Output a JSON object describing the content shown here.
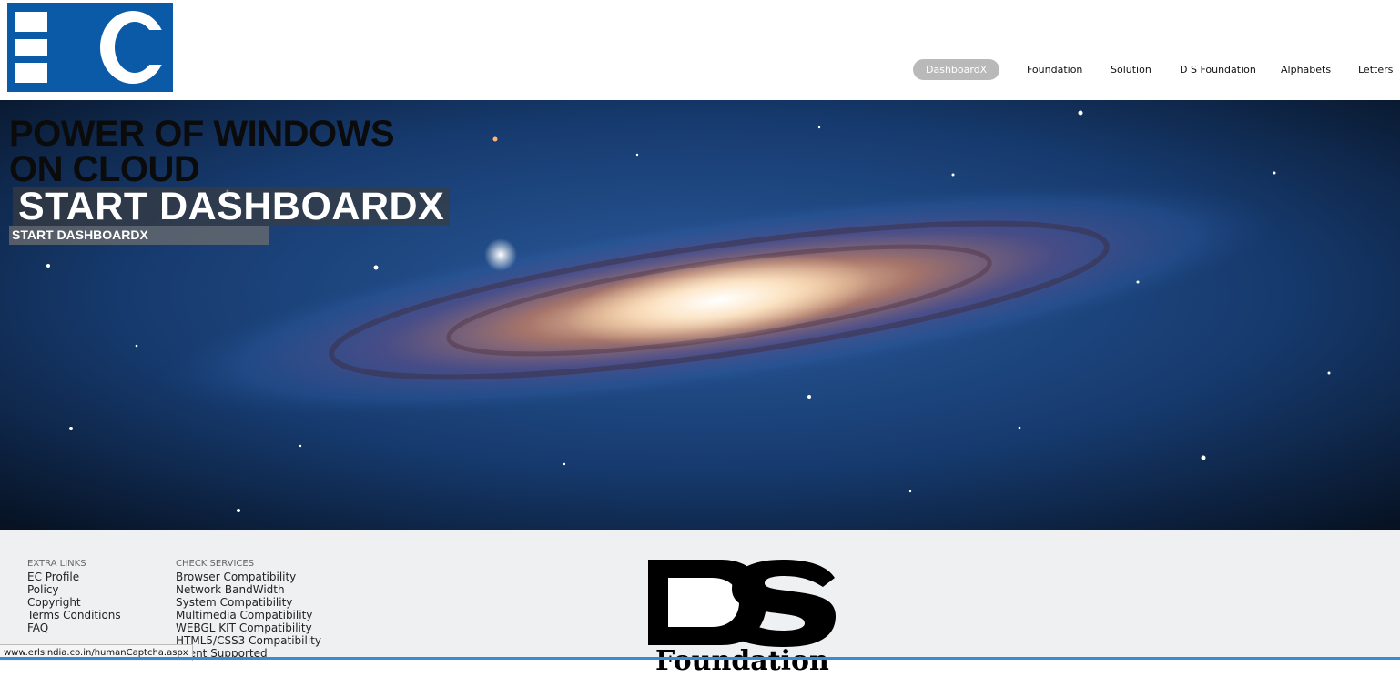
{
  "header": {
    "logo_text": "EC",
    "nav": [
      {
        "label": "DashboardX",
        "active": true
      },
      {
        "label": "Foundation",
        "active": false
      },
      {
        "label": "Solution",
        "active": false
      },
      {
        "label": "D S Foundation",
        "active": false
      },
      {
        "label": "Alphabets",
        "active": false
      },
      {
        "label": "Letters",
        "active": false
      }
    ]
  },
  "hero": {
    "headline_line1": "POWER OF WINDOWS",
    "headline_line2": "ON CLOUD",
    "cta_large": "START DASHBOARDX",
    "cta_small": "START DASHBOARDX"
  },
  "footer": {
    "extra_links": {
      "title": "EXTRA LINKS",
      "items": [
        "EC Profile",
        "Policy",
        "Copyright",
        "Terms Conditions",
        "FAQ"
      ]
    },
    "check_services": {
      "title": "CHECK SERVICES",
      "items": [
        "Browser Compatibility",
        "Network BandWidth",
        "System Compatibility",
        "Multimedia Compatibility",
        "WEBGL KIT Compatibility",
        "HTML5/CSS3 Compatibility",
        "Event Supported"
      ]
    },
    "ds_logo_text": "DS",
    "ds_subtitle": "Foundation"
  },
  "status_bar": {
    "url": "www.erlsindia.co.in/humanCaptcha.aspx"
  },
  "colors": {
    "logo_blue": "#0a5aa8",
    "nav_active_bg": "#b9b9b9",
    "footer_bg": "#eef0f2"
  }
}
